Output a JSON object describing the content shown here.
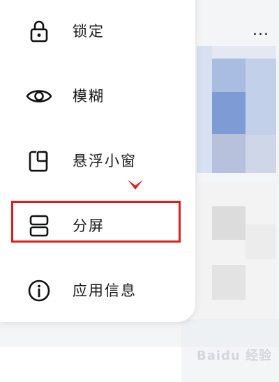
{
  "menu": {
    "items": [
      {
        "label": "锁定",
        "icon": "lock-icon"
      },
      {
        "label": "模糊",
        "icon": "eye-icon"
      },
      {
        "label": "悬浮小窗",
        "icon": "floating-window-icon"
      },
      {
        "label": "分屏",
        "icon": "split-screen-icon"
      },
      {
        "label": "应用信息",
        "icon": "info-icon"
      }
    ]
  },
  "background": {
    "more_label": "..."
  },
  "annotation": {
    "highlight_color": "#e01d1d",
    "highlighted_item": "分屏"
  },
  "watermark": {
    "text": "Baidu 经验"
  }
}
